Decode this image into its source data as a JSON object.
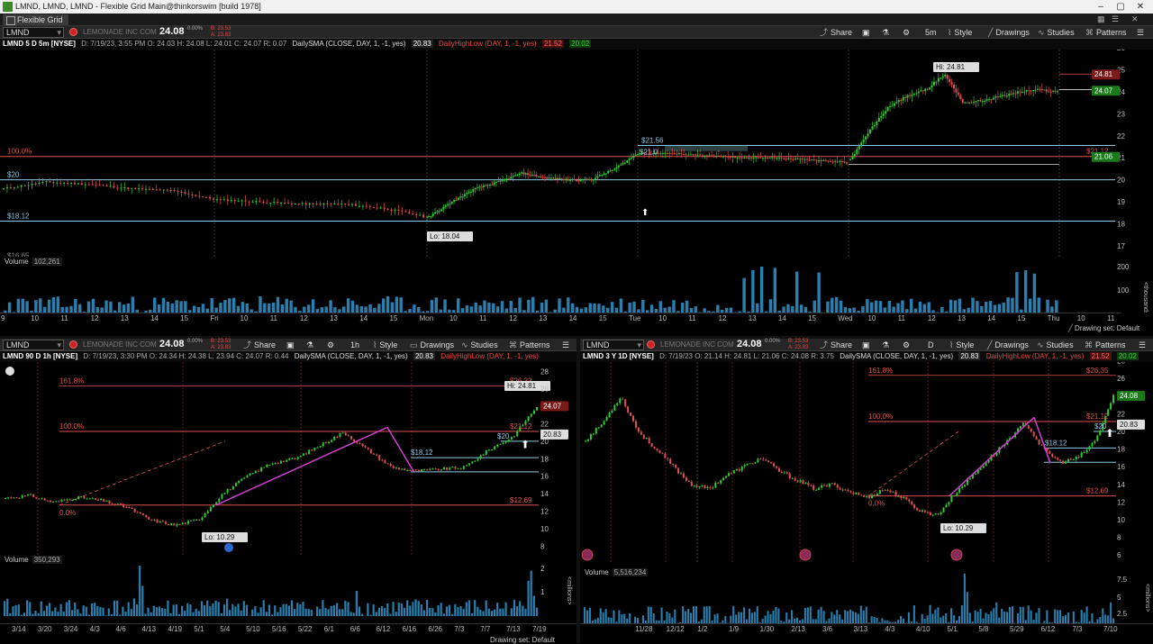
{
  "window": {
    "title": "LMND, LMND, LMND - Flexible Grid Main@thinkorswim [build 1978]",
    "controls": [
      "–",
      "▢",
      "✕"
    ]
  },
  "tabbar": {
    "tab": "Flexible Grid",
    "controls": [
      "▦",
      "☰",
      "✕"
    ]
  },
  "colors": {
    "bg": "#000000",
    "up": "#2ecc2e",
    "down": "#e05050",
    "fib": "#e05050",
    "level": "#8ecae6",
    "pink": "#d040d0",
    "grid": "#222222"
  },
  "top": {
    "symbol": "LMND",
    "company": "LEMONADE INC COM",
    "last": "24.08",
    "chg1": "0.00%",
    "chg2a": "B: 23.53",
    "chg2b": "A: 23.83",
    "buttons": {
      "share": "Share",
      "style": "Style",
      "drawings": "Drawings",
      "studies": "Studies",
      "patterns": "Patterns",
      "timeframe": "5m"
    },
    "info": {
      "desc": "LMND 5 D 5m [NYSE]",
      "quote": "D: 7/19/23, 3:55 PM  O: 24.03  H: 24.08  L: 24.01  C: 24.07  R: 0.07",
      "sma": "DailySMA (CLOSE, DAY, 1, -1, yes)",
      "sma_val": "20.83",
      "hl": "DailyHighLow (DAY, 1, -1, yes)",
      "hl_hi": "21.52",
      "hl_lo": "20.02"
    },
    "labels": {
      "hi": "Hi: 24.81",
      "lo": "Lo: 18.04",
      "fib100": "100.0%",
      "l21_56": "$21.56",
      "l21_0": "$21.0",
      "l20": "$20",
      "l18_12": "$18.12",
      "l21_12": "$21.12",
      "l16": "$16.65"
    },
    "price_tags": {
      "a": "24.81",
      "b": "24.07",
      "c": "21.06"
    },
    "yaxis": [
      "26",
      "25",
      "24",
      "23",
      "22",
      "21",
      "20",
      "19",
      "18",
      "17"
    ],
    "volume": {
      "label": "Volume",
      "value": "102,261",
      "axis": [
        "200",
        "100"
      ],
      "unit": "<thousands>"
    },
    "xaxis": [
      "9",
      "10",
      "11",
      "12",
      "13",
      "14",
      "15",
      "Fri",
      "10",
      "11",
      "12",
      "13",
      "14",
      "15",
      "Mon",
      "10",
      "11",
      "12",
      "13",
      "14",
      "15",
      "Tue",
      "10",
      "11",
      "12",
      "13",
      "14",
      "15",
      "Wed",
      "10",
      "11",
      "12",
      "13",
      "14",
      "15",
      "Thu",
      "10",
      "11"
    ],
    "drawing_set": "Drawing set: Default"
  },
  "bl": {
    "symbol": "LMND",
    "company": "LEMONADE INC COM",
    "last": "24.08",
    "chg1": "0.00%",
    "chg2a": "B: 23.53",
    "chg2b": "A: 23.83",
    "buttons": {
      "share": "Share",
      "style": "Style",
      "drawings": "Drawings",
      "studies": "Studies",
      "patterns": "Patterns",
      "timeframe": "1h"
    },
    "info": {
      "desc": "LMND 90 D 1h [NYSE]",
      "quote": "D: 7/19/23, 3:30 PM  O: 24.34  H: 24.38  L: 23.94  C: 24.07  R: 0.44",
      "sma": "DailySMA (CLOSE, DAY, 1, -1, yes)",
      "sma_val": "20.83",
      "hl": "DailyHighLow (DAY, 1, -1, yes)"
    },
    "labels": {
      "fib161": "161.8%",
      "fib100": "100.0%",
      "fib0": "0.0%",
      "l26": "$26.33",
      "l21": "$21.12",
      "l20": "$20",
      "l18": "$18.12",
      "l12": "$12.69",
      "hi": "Hi: 24.81",
      "lo": "Lo: 10.29"
    },
    "price_tags": {
      "a": "24.07",
      "b": "20.83"
    },
    "yaxis": [
      "28",
      "26",
      "24",
      "22",
      "20",
      "18",
      "16",
      "14",
      "12",
      "10",
      "8"
    ],
    "volume": {
      "label": "Volume",
      "value": "350,293",
      "axis": [
        "2",
        "1"
      ],
      "unit": "<millions>"
    },
    "xaxis": [
      "3/14",
      "3/20",
      "3/24",
      "4/3",
      "4/6",
      "4/13",
      "4/19",
      "5/1",
      "5/4",
      "5/10",
      "5/16",
      "5/22",
      "6/1",
      "6/6",
      "6/12",
      "6/16",
      "6/26",
      "7/3",
      "7/7",
      "7/13",
      "7/19"
    ],
    "drawing_set": "Drawing set: Default"
  },
  "br": {
    "symbol": "LMND",
    "company": "LEMONADE INC COM",
    "last": "24.08",
    "chg1": "0.00%",
    "chg2a": "B: 23.53",
    "chg2b": "A: 23.83",
    "buttons": {
      "share": "Share",
      "style": "Style",
      "drawings": "Drawings",
      "studies": "Studies",
      "patterns": "Patterns",
      "timeframe": "D"
    },
    "info": {
      "desc": "LMND 3 Y 1D [NYSE]",
      "quote": "D: 7/19/23  O: 21.14  H: 24.81  L: 21.06  C: 24.08  R: 3.75",
      "sma": "DailySMA (CLOSE, DAY, 1, -1, yes)",
      "sma_val": "20.83",
      "hl": "DailyHighLow (DAY, 1, -1, yes)",
      "hl_hi": "21.52",
      "hl_lo": "20.02"
    },
    "labels": {
      "fib161": "161.8%",
      "fib100": "100.0%",
      "fib0": "0.0%",
      "l26": "$26.35",
      "l21": "$21.12",
      "l20": "$20",
      "l18": "$18.12",
      "l12": "$12.69",
      "lo": "Lo: 10.29"
    },
    "price_tags": {
      "a": "24.08",
      "b": "20.83"
    },
    "yaxis": [
      "28",
      "26",
      "24",
      "22",
      "20",
      "18",
      "16",
      "14",
      "12",
      "10",
      "8",
      "6"
    ],
    "volume": {
      "label": "Volume",
      "value": "5,516,234",
      "axis": [
        "7.5",
        "5",
        "2.5"
      ],
      "unit": "<millions>"
    },
    "xaxis": [
      "11/28",
      "12/12",
      "1/2",
      "1/9",
      "1/30",
      "2/13",
      "3/6",
      "3/13",
      "4/3",
      "4/10",
      "5/1",
      "5/8",
      "5/29",
      "6/12",
      "7/3",
      "7/10"
    ],
    "drawing_set": "Drawing set: Default"
  }
}
